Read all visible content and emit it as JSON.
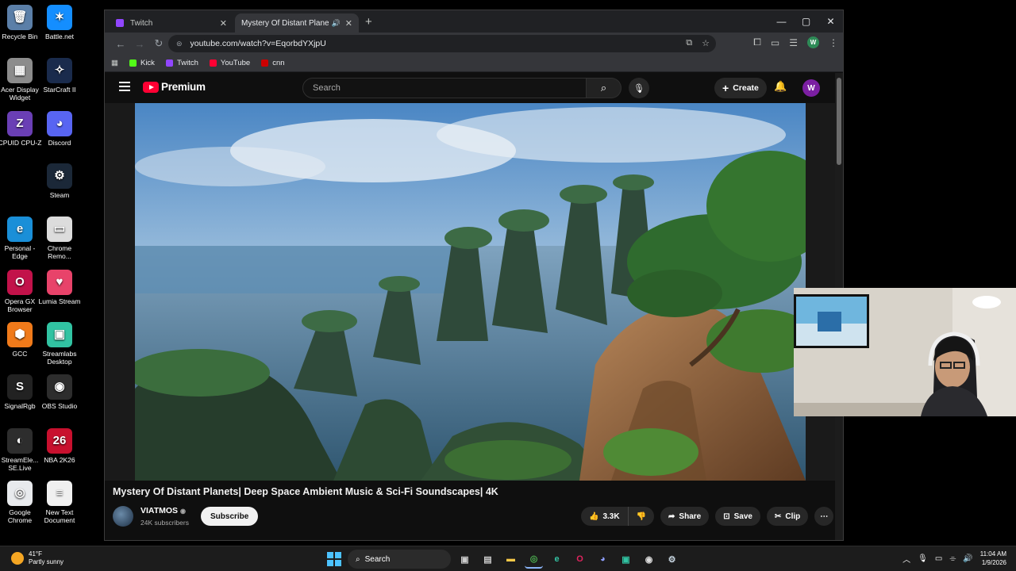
{
  "desktop": {
    "icons": [
      {
        "label": "Recycle Bin",
        "color": "#5b7fa8",
        "glyph": "🗑"
      },
      {
        "label": "Battle.net",
        "color": "#148eff",
        "glyph": "✶"
      },
      {
        "label": "Acer Display Widget",
        "color": "#8c8c8c",
        "glyph": "▦"
      },
      {
        "label": "StarCraft II",
        "color": "#1a2b4c",
        "glyph": "✧"
      },
      {
        "label": "CPUID CPU-Z",
        "color": "#6a3fb5",
        "glyph": "Z"
      },
      {
        "label": "Discord",
        "color": "#5865f2",
        "glyph": "◕"
      },
      {
        "label": "Steam",
        "color": "#1b2838",
        "glyph": "⚙"
      },
      {
        "label": "Personal - Edge",
        "color": "#1a8fd8",
        "glyph": "e"
      },
      {
        "label": "Chrome Remo...",
        "color": "#dcdcdc",
        "glyph": "▭"
      },
      {
        "label": "Opera GX Browser",
        "color": "#c2124a",
        "glyph": "O"
      },
      {
        "label": "Lumia Stream",
        "color": "#e8436a",
        "glyph": "♥"
      },
      {
        "label": "GCC",
        "color": "#f07a1a",
        "glyph": "⬢"
      },
      {
        "label": "Streamlabs Desktop",
        "color": "#31c3a2",
        "glyph": "▣"
      },
      {
        "label": "SignalRgb",
        "color": "#222222",
        "glyph": "S"
      },
      {
        "label": "OBS Studio",
        "color": "#2d2d2d",
        "glyph": "◉"
      },
      {
        "label": "StreamEle... SE.Live",
        "color": "#2d2d2d",
        "glyph": "◐"
      },
      {
        "label": "NBA 2K26",
        "color": "#c8102e",
        "glyph": "26"
      },
      {
        "label": "Google Chrome",
        "color": "#e8eaed",
        "glyph": "◎"
      },
      {
        "label": "New Text Document",
        "color": "#f0f0f0",
        "glyph": "≡"
      }
    ]
  },
  "browser": {
    "tabs": [
      {
        "title": "Twitch",
        "favicon": "twitch-icon"
      },
      {
        "title": "Mystery Of Distant Planets",
        "favicon": "youtube-icon"
      }
    ],
    "new_tab": "+",
    "url": "youtube.com/watch?v=EqorbdYXjpU",
    "profile_initial": "W",
    "bookmarks": [
      {
        "label": "Kick",
        "color": "#53fc18"
      },
      {
        "label": "Twitch",
        "color": "#9146ff"
      },
      {
        "label": "YouTube",
        "color": "#ff0033"
      },
      {
        "label": "cnn",
        "color": "#cc0000"
      }
    ]
  },
  "youtube": {
    "logo_text": "Premium",
    "search_placeholder": "Search",
    "create_label": "Create",
    "avatar_initial": "W",
    "video_title": "Mystery Of Distant Planets| Deep Space Ambient Music & Sci-Fi Soundscapes| 4K",
    "channel_name": "VIATMOS",
    "subscribers": "24K subscribers",
    "subscribe_label": "Subscribe",
    "likes": "3.3K",
    "share_label": "Share",
    "save_label": "Save",
    "clip_label": "Clip"
  },
  "taskbar": {
    "weather_temp": "41°F",
    "weather_desc": "Partly sunny",
    "search_label": "Search",
    "time": "11:04 AM",
    "date": "1/9/2026"
  }
}
